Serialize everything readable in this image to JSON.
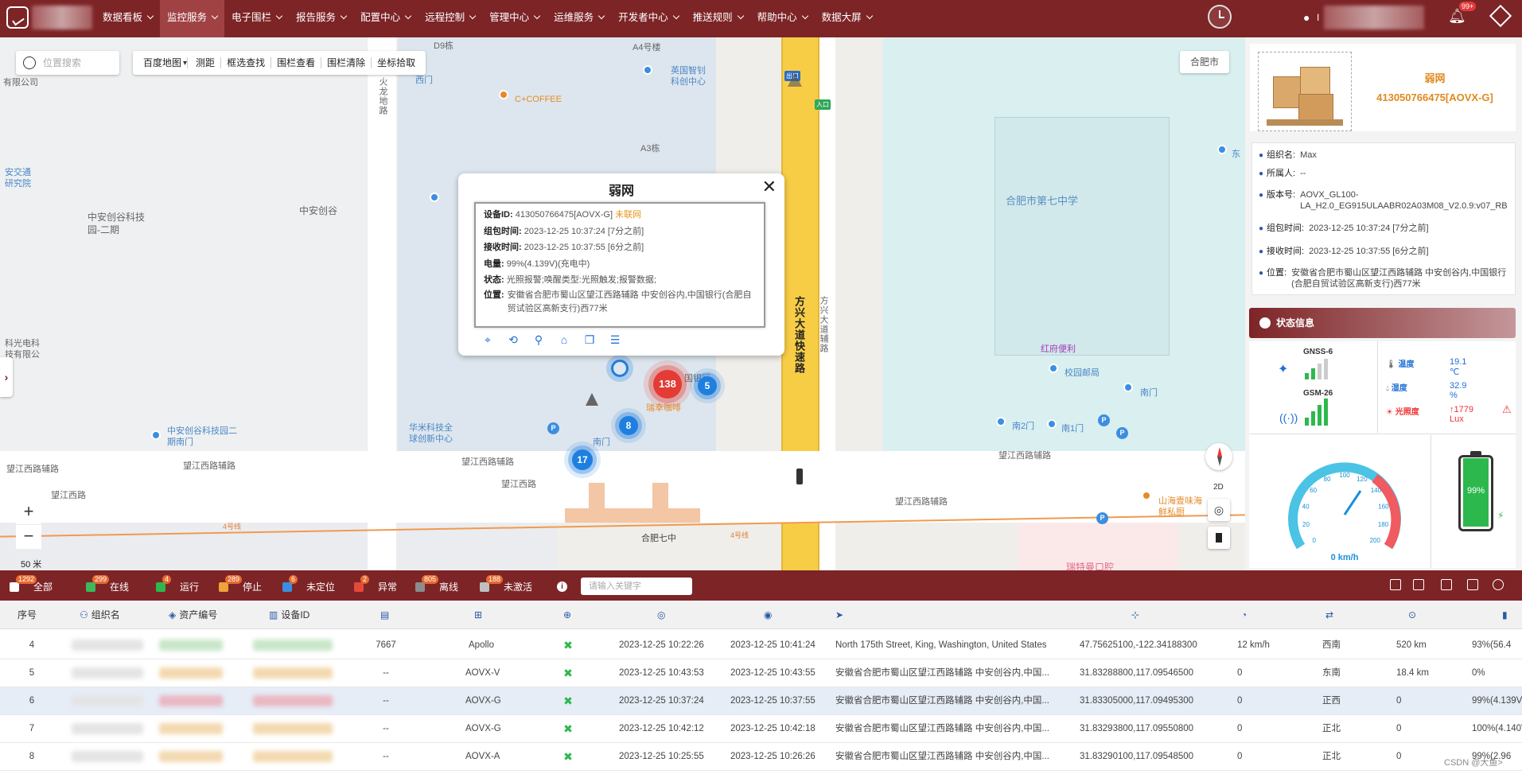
{
  "nav": {
    "items": [
      "数据看板",
      "监控服务",
      "电子围栏",
      "报告服务",
      "配置中心",
      "远程控制",
      "管理中心",
      "运维服务",
      "开发者中心",
      "推送规则",
      "帮助中心",
      "数据大屏"
    ],
    "active_index": 1,
    "notification_count": "99+",
    "user_initial": "I"
  },
  "map": {
    "search_placeholder": "位置搜索",
    "tools": [
      "百度地图",
      "测距",
      "框选查找",
      "围栏查看",
      "围栏清除",
      "坐标拾取"
    ],
    "city": "合肥市",
    "zoom_in": "+",
    "zoom_out": "−",
    "scale": "50 米",
    "compass_2d": "2D",
    "labels": {
      "school": "合肥市第七中学",
      "park": "中安创谷科技园-二期",
      "chuang": "中安创谷",
      "fangxing": "方兴大道快速路",
      "fangxing2": "方兴大道辅路",
      "wangjiang1": "望江西路辅路",
      "wangjiang2": "望江西路",
      "wangjiang3": "望江西路辅路",
      "wangjiang4": "望江西路辅路",
      "wangjiang5": "望江西路",
      "wangjiang6": "望江西路辅路",
      "wangjiang7": "望江西路辅路",
      "huolong": "火龙地路",
      "coffee": "C+COFFEE",
      "ying": "英国智钊科创中心",
      "a3": "A3栋",
      "a4": "A4号楼",
      "d9": "D9栋",
      "xi": "西门",
      "gate": "出口",
      "entry": "入口",
      "south1": "南门",
      "south2": "南2门",
      "south3": "南1门",
      "south4": "南门",
      "campus": "校园邮局",
      "hongfu": "红府便利",
      "qixiao": "合肥七中",
      "huake": "华米科技全球创新中心",
      "kechuang": "中安创谷科技园二期南门",
      "shanhai": "山海壹味海鲜私厨",
      "ruite": "瑞特曼口腔",
      "ruixing": "瑞幸咖啡",
      "line4a": "4号线",
      "line4b": "4号线",
      "jiaotong": "安交通研究院",
      "kexin": "科光电科技有限公司",
      "you": "有限公司",
      "yhang": "国银行",
      "east": "东"
    },
    "clusters": [
      "138",
      "5",
      "8",
      "17"
    ]
  },
  "popup": {
    "title": "弱网",
    "close": "✕",
    "device_id_label": "设备ID:",
    "device_id": "413050766475[AOVX-G]",
    "device_status": "未联网",
    "pack_time_label": "组包时间:",
    "pack_time": "2023-12-25 10:37:24 [7分之前]",
    "recv_time_label": "接收时间:",
    "recv_time": "2023-12-25 10:37:55 [6分之前]",
    "battery_label": "电量:",
    "battery": "99%(4.139V)(充电中)",
    "state_label": "状态:",
    "state": "光照报警;唤醒类型:光照触发;报警数据;",
    "location_label": "位置:",
    "location": "安徽省合肥市蜀山区望江西路辅路 中安创谷内,中国银行(合肥自贸试验区高新支行)西77米"
  },
  "device_panel": {
    "name": "弱网",
    "id": "413050766475[AOVX-G]",
    "info": [
      {
        "k": "组织名:",
        "v": "Max"
      },
      {
        "k": "所属人:",
        "v": "--"
      },
      {
        "k": "版本号:",
        "v": "AOVX_GL100-LA_H2.0_EG915ULAABR02A03M08_V2.0.9:v07_RB"
      },
      {
        "k": "组包时间:",
        "v": "2023-12-25 10:37:24 [7分之前]"
      },
      {
        "k": "接收时间:",
        "v": "2023-12-25 10:37:55 [6分之前]"
      },
      {
        "k": "位置:",
        "v": "安徽省合肥市蜀山区望江西路辅路 中安创谷内,中国银行(合肥自贸试验区高新支行)西77米"
      }
    ],
    "status_title": "状态信息",
    "gnss_label": "GNSS-6",
    "gsm_label": "GSM-26",
    "temp_label": "温度",
    "temp": "19.1 ℃",
    "humidity_label": "湿度",
    "humidity": "32.9 %",
    "light_label": "光照度",
    "light": "↑1779 Lux",
    "speed": "0 km/h",
    "battery_pct": "99%",
    "speed_ticks": [
      "0",
      "20",
      "40",
      "60",
      "80",
      "100",
      "120",
      "140",
      "160",
      "180",
      "200"
    ]
  },
  "filters": [
    {
      "count": "1292",
      "label": "全部",
      "color": "#ffffff"
    },
    {
      "count": "299",
      "label": "在线",
      "color": "#3cb85d"
    },
    {
      "count": "4",
      "label": "运行",
      "color": "#2db84d"
    },
    {
      "count": "289",
      "label": "停止",
      "color": "#f0a33a"
    },
    {
      "count": "6",
      "label": "未定位",
      "color": "#3b8ee0"
    },
    {
      "count": "2",
      "label": "异常",
      "color": "#e44a3a"
    },
    {
      "count": "805",
      "label": "离线",
      "color": "#8c8c8c"
    },
    {
      "count": "188",
      "label": "未激活",
      "color": "#bfbfbf"
    }
  ],
  "keyword_placeholder": "请输入关键字",
  "table": {
    "headers": [
      "序号",
      "组织名",
      "资产编号",
      "设备ID",
      "",
      "",
      "",
      "",
      "",
      "",
      "",
      "",
      "",
      "",
      ""
    ],
    "rows": [
      {
        "no": "4",
        "code": "7667",
        "model": "Apollo",
        "pack": "2023-12-25 10:22:26",
        "recv": "2023-12-25 10:41:24",
        "addr": "North 175th Street, King, Washington, United States",
        "coord": "47.75625100,-122.34188300",
        "speed": "12 km/h",
        "dir": "西南",
        "mileage": "520 km",
        "batt": "93%(56.4"
      },
      {
        "no": "5",
        "code": "--",
        "model": "AOVX-V",
        "pack": "2023-12-25 10:43:53",
        "recv": "2023-12-25 10:43:55",
        "addr": "安徽省合肥市蜀山区望江西路辅路 中安创谷内,中国...",
        "coord": "31.83288800,117.09546500",
        "speed": "0",
        "dir": "东南",
        "mileage": "18.4 km",
        "batt": "0%"
      },
      {
        "no": "6",
        "code": "--",
        "model": "AOVX-G",
        "pack": "2023-12-25 10:37:24",
        "recv": "2023-12-25 10:37:55",
        "addr": "安徽省合肥市蜀山区望江西路辅路 中安创谷内,中国...",
        "coord": "31.83305000,117.09495300",
        "speed": "0",
        "dir": "正西",
        "mileage": "0",
        "batt": "99%(4.139V)"
      },
      {
        "no": "7",
        "code": "--",
        "model": "AOVX-G",
        "pack": "2023-12-25 10:42:12",
        "recv": "2023-12-25 10:42:18",
        "addr": "安徽省合肥市蜀山区望江西路辅路 中安创谷内,中国...",
        "coord": "31.83293800,117.09550800",
        "speed": "0",
        "dir": "正北",
        "mileage": "0",
        "batt": "100%(4.140V"
      },
      {
        "no": "8",
        "code": "--",
        "model": "AOVX-A",
        "pack": "2023-12-25 10:25:55",
        "recv": "2023-12-25 10:26:26",
        "addr": "安徽省合肥市蜀山区望江西路辅路 中安创谷内,中国...",
        "coord": "31.83290100,117.09548500",
        "speed": "0",
        "dir": "正北",
        "mileage": "0",
        "batt": "99%(2.96"
      }
    ]
  },
  "watermark": "CSDN @大鱼>"
}
